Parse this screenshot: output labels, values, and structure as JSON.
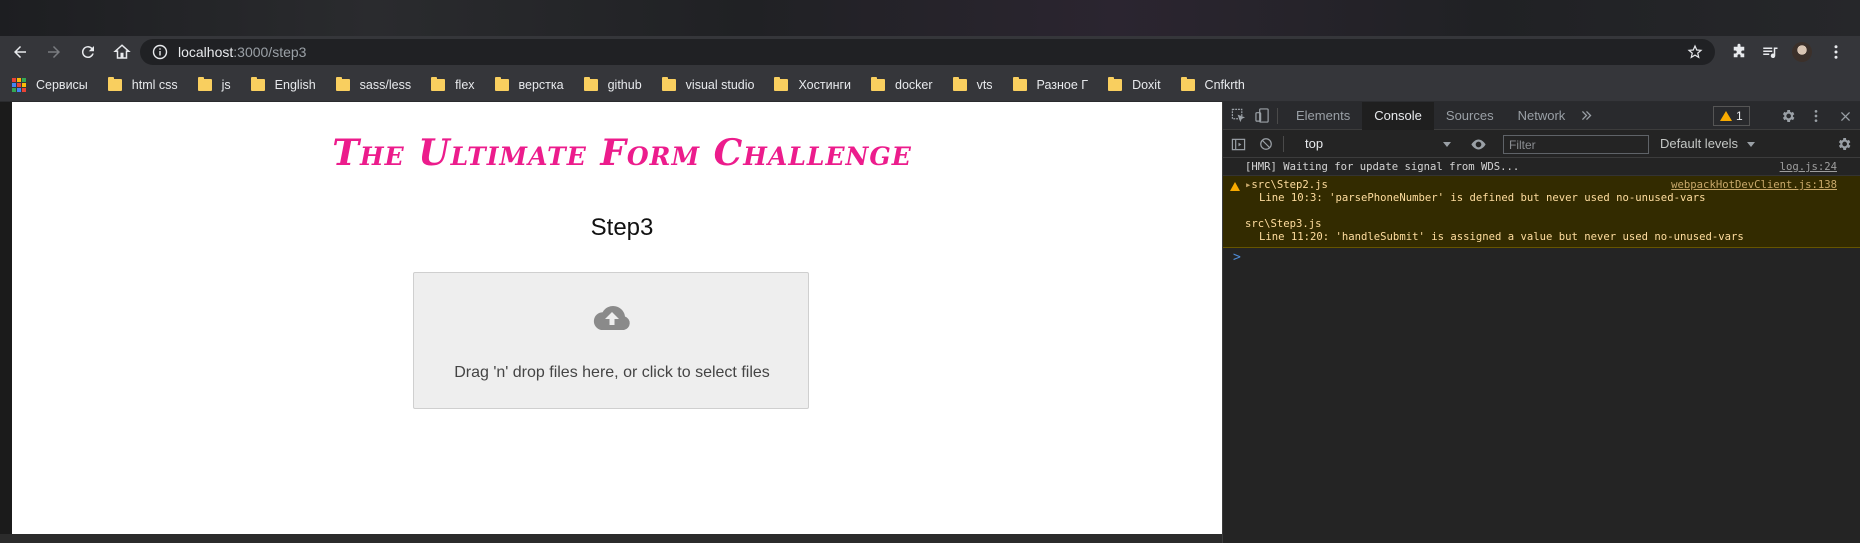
{
  "browser": {
    "url_host": "localhost",
    "url_path": ":3000/step3"
  },
  "bookmarks": [
    {
      "label": "Сервисы",
      "icon": "apps-grid-icon"
    },
    {
      "label": "html css",
      "icon": "folder-icon"
    },
    {
      "label": "js",
      "icon": "folder-icon"
    },
    {
      "label": "English",
      "icon": "folder-icon"
    },
    {
      "label": "sass/less",
      "icon": "folder-icon"
    },
    {
      "label": "flex",
      "icon": "folder-icon"
    },
    {
      "label": "верстка",
      "icon": "folder-icon"
    },
    {
      "label": "github",
      "icon": "folder-icon"
    },
    {
      "label": "visual studio",
      "icon": "folder-icon"
    },
    {
      "label": "Хостинги",
      "icon": "folder-icon"
    },
    {
      "label": "docker",
      "icon": "folder-icon"
    },
    {
      "label": "vts",
      "icon": "folder-icon"
    },
    {
      "label": "Разное Г",
      "icon": "folder-icon"
    },
    {
      "label": "Doxit",
      "icon": "folder-icon"
    },
    {
      "label": "Cnfkrth",
      "icon": "folder-icon"
    }
  ],
  "page": {
    "title": "The Ultimate Form Challenge",
    "step": "Step3",
    "dropzone_text": "Drag 'n' drop files here, or click to select files",
    "title_color": "#ec1c8c"
  },
  "devtools": {
    "tabs": [
      "Elements",
      "Console",
      "Sources",
      "Network"
    ],
    "active_tab": "Console",
    "warning_count": "1",
    "context": "top",
    "filter_placeholder": "Filter",
    "levels": "Default levels",
    "console": {
      "hmr_text": "[HMR] Waiting for update signal from WDS...",
      "hmr_source": "log.js:24",
      "warn_file1": "src\\Step2.js",
      "warn_source": "webpackHotDevClient.js:138",
      "warn_line1": "Line 10:3:  'parsePhoneNumber' is defined but never used  no-unused-vars",
      "warn_file2": "src\\Step3.js",
      "warn_line2": "Line 11:20:  'handleSubmit' is assigned a value but never used  no-unused-vars",
      "prompt": ">"
    }
  }
}
